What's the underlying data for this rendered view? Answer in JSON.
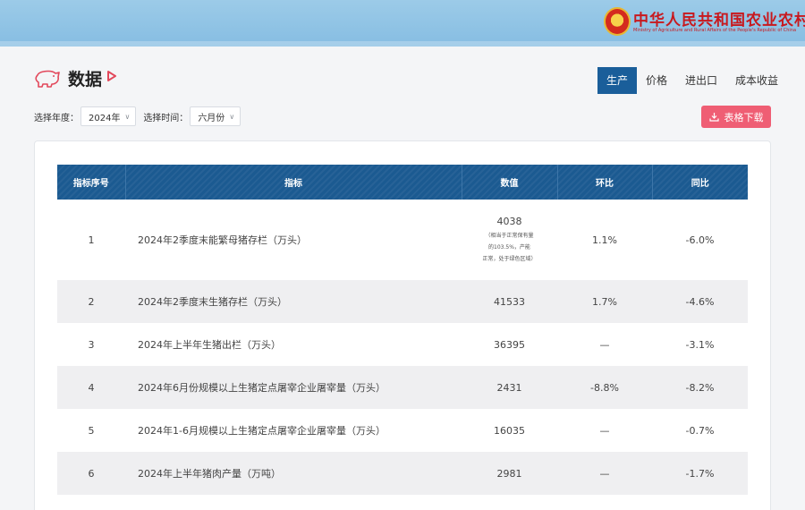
{
  "header": {
    "ministry_cn": "中华人民共和国农业农村部",
    "ministry_en": "Ministry of Agriculture and Rural Affairs of the People's Republic of China"
  },
  "page": {
    "title": "数据"
  },
  "tabs": [
    {
      "label": "生产",
      "active": true
    },
    {
      "label": "价格",
      "active": false
    },
    {
      "label": "进出口",
      "active": false
    },
    {
      "label": "成本收益",
      "active": false
    }
  ],
  "filters": {
    "year_label": "选择年度：",
    "year_value": "2024年",
    "time_label": "选择时间：",
    "time_value": "六月份"
  },
  "download_label": "表格下载",
  "colors": {
    "accent": "#1a5e9a",
    "download": "#ef5e74",
    "banner": "#8fc3e5"
  },
  "table": {
    "headers": [
      "指标序号",
      "指标",
      "数值",
      "环比",
      "同比"
    ],
    "rows": [
      {
        "no": "1",
        "indicator": "2024年2季度末能繁母猪存栏（万头）",
        "value": "4038",
        "note_lines": [
          "（相当于正常保有量",
          "的103.5%，产能",
          "正常，处于绿色区域）"
        ],
        "mom": "1.1%",
        "yoy": "-6.0%"
      },
      {
        "no": "2",
        "indicator": "2024年2季度末生猪存栏（万头）",
        "value": "41533",
        "mom": "1.7%",
        "yoy": "-4.6%"
      },
      {
        "no": "3",
        "indicator": "2024年上半年生猪出栏（万头）",
        "value": "36395",
        "mom": "—",
        "yoy": "-3.1%"
      },
      {
        "no": "4",
        "indicator": "2024年6月份规模以上生猪定点屠宰企业屠宰量（万头）",
        "value": "2431",
        "mom": "-8.8%",
        "yoy": "-8.2%"
      },
      {
        "no": "5",
        "indicator": "2024年1-6月规模以上生猪定点屠宰企业屠宰量（万头）",
        "value": "16035",
        "mom": "—",
        "yoy": "-0.7%"
      },
      {
        "no": "6",
        "indicator": "2024年上半年猪肉产量（万吨）",
        "value": "2981",
        "mom": "—",
        "yoy": "-1.7%"
      }
    ]
  }
}
